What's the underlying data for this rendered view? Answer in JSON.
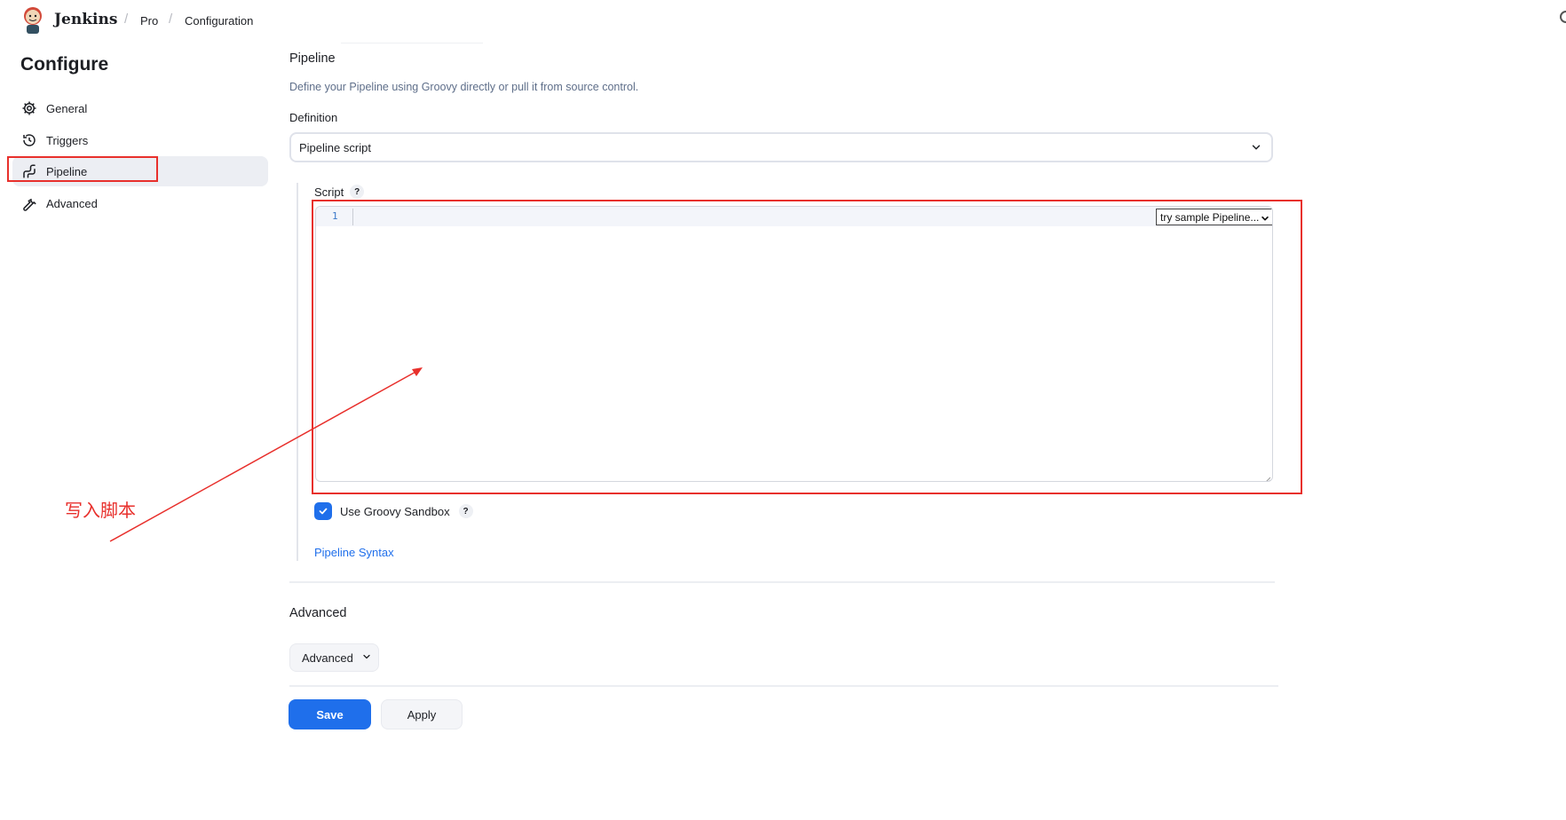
{
  "header": {
    "brand": "Jenkins",
    "breadcrumbs": [
      "Pro",
      "Configuration"
    ]
  },
  "sidebar": {
    "title": "Configure",
    "items": [
      {
        "label": "General",
        "icon": "gear-icon"
      },
      {
        "label": "Triggers",
        "icon": "clock-icon"
      },
      {
        "label": "Pipeline",
        "icon": "pipeline-icon",
        "active": true
      },
      {
        "label": "Advanced",
        "icon": "wrench-icon"
      }
    ]
  },
  "pipeline": {
    "title": "Pipeline",
    "description": "Define your Pipeline using Groovy directly or pull it from source control.",
    "definition_label": "Definition",
    "definition_value": "Pipeline script",
    "script_label": "Script",
    "help": "?",
    "line_number": "1",
    "sample_select": "try sample Pipeline...",
    "sandbox_label": "Use Groovy Sandbox",
    "sandbox_checked": true,
    "syntax_link": "Pipeline Syntax"
  },
  "advanced": {
    "title": "Advanced",
    "button": "Advanced"
  },
  "actions": {
    "save": "Save",
    "apply": "Apply"
  },
  "annotation": {
    "text": "写入脚本",
    "color": "#e8302c"
  },
  "colors": {
    "accent": "#1f6feb",
    "active_bg": "#eceef3"
  }
}
